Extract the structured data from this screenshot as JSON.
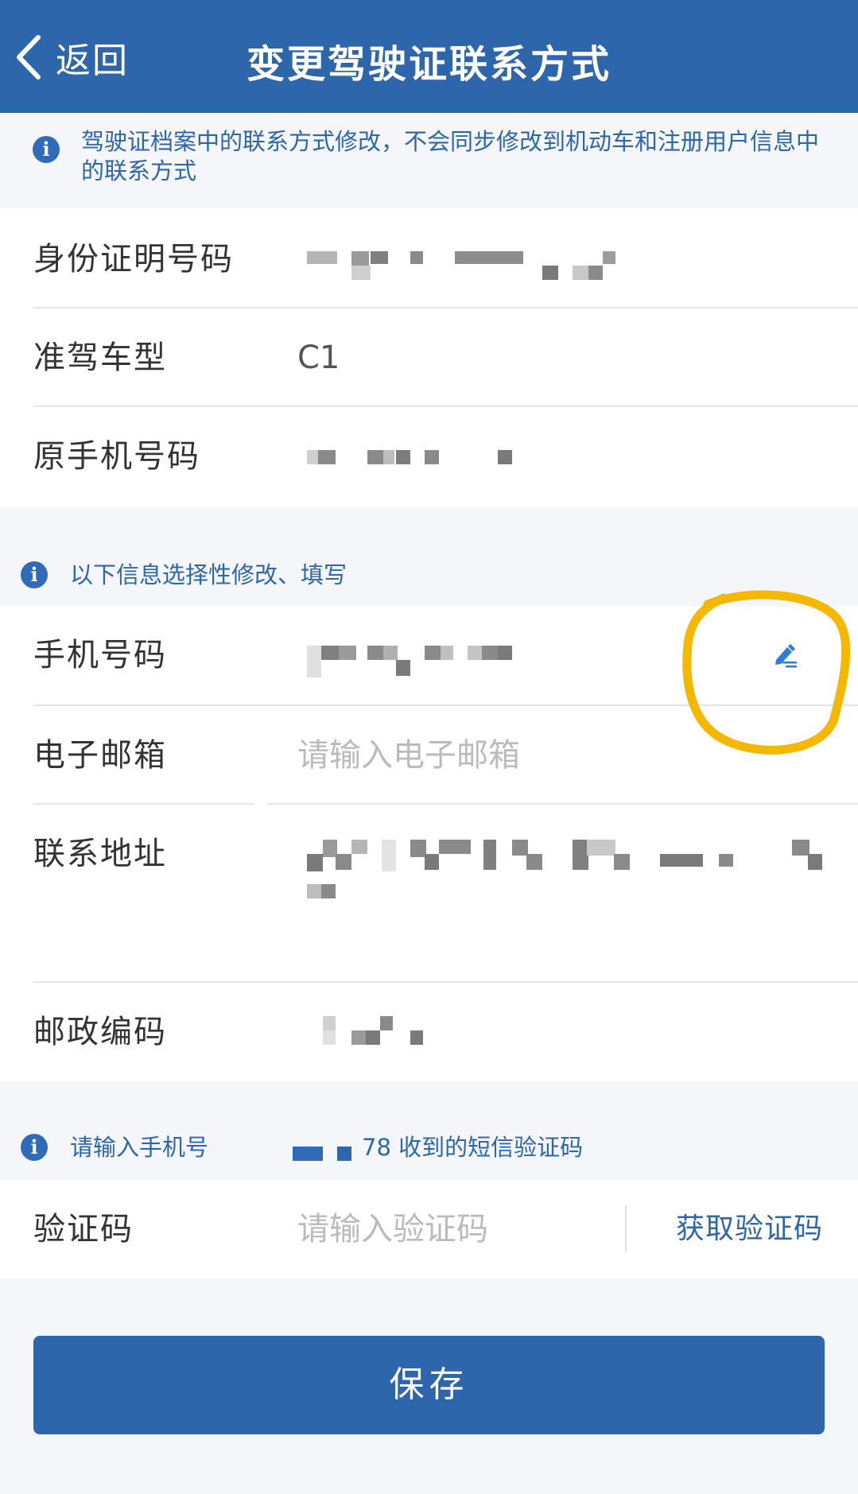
{
  "header": {
    "back_label": "返回",
    "title": "变更驾驶证联系方式",
    "bg_color": "#2e66ac"
  },
  "notice_top": {
    "icon": "info-icon",
    "text": "驾驶证档案中的联系方式修改，不会同步修改到机动车和注册用户信息中的联系方式"
  },
  "license_info": {
    "id_label": "身份证明号码",
    "id_value_masked": true,
    "class_label": "准驾车型",
    "class_value": "C1",
    "old_phone_label": "原手机号码",
    "old_phone_masked": true
  },
  "notice_optional": {
    "icon": "info-icon",
    "text": "以下信息选择性修改、填写"
  },
  "contact_form": {
    "phone_label": "手机号码",
    "phone_masked": true,
    "phone_edit_icon": "edit-pencil-icon",
    "email_label": "电子邮箱",
    "email_placeholder": "请输入电子邮箱",
    "address_label": "联系地址",
    "address_masked": true,
    "postcode_label": "邮政编码",
    "postcode_masked": true
  },
  "notice_sms": {
    "icon": "info-icon",
    "text_start": "请输入手机号",
    "text_end": "78 收到的短信验证码"
  },
  "verification": {
    "label": "验证码",
    "placeholder": "请输入验证码",
    "get_code_label": "获取验证码"
  },
  "save_button": {
    "label": "保存"
  },
  "annotation": {
    "highlight_color": "#f5b800"
  }
}
